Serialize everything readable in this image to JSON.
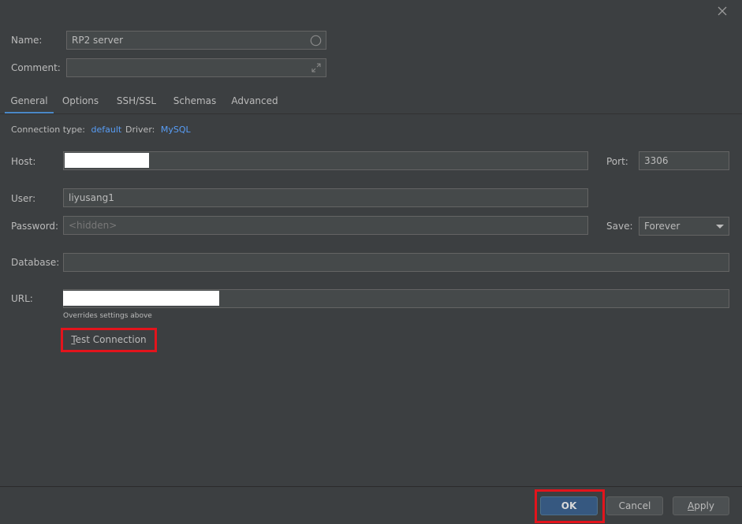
{
  "icons": {
    "close": "close-icon",
    "name_status": "circle-status-icon",
    "expand": "expand-icon",
    "dropdown": "chevron-down-icon"
  },
  "general": {
    "name_label": "Name:",
    "name_value": "RP2 server",
    "comment_label": "Comment:",
    "comment_value": ""
  },
  "tabs": [
    {
      "label": "General",
      "active": true
    },
    {
      "label": "Options"
    },
    {
      "label": "SSH/SSL"
    },
    {
      "label": "Schemas"
    },
    {
      "label": "Advanced"
    }
  ],
  "connection": {
    "type_label": "Connection type:",
    "type_value": "default",
    "driver_label": "Driver:",
    "driver_value": "MySQL"
  },
  "form": {
    "host_label": "Host:",
    "port_label": "Port:",
    "port_value": "3306",
    "user_label": "User:",
    "user_value": "liyusang1",
    "password_label": "Password:",
    "password_placeholder": "<hidden>",
    "save_label": "Save:",
    "save_value": "Forever",
    "database_label": "Database:",
    "database_value": "",
    "url_label": "URL:",
    "url_hint": "Overrides settings above"
  },
  "test_connection": {
    "mnemonic": "T",
    "rest": "est Connection"
  },
  "footer": {
    "ok": "OK",
    "cancel": "Cancel",
    "apply_mnemonic": "A",
    "apply_rest": "pply"
  },
  "colors": {
    "accent": "#589df6",
    "primary_button": "#365880",
    "highlight": "#e3141c",
    "tab_active": "#4a88c7"
  }
}
